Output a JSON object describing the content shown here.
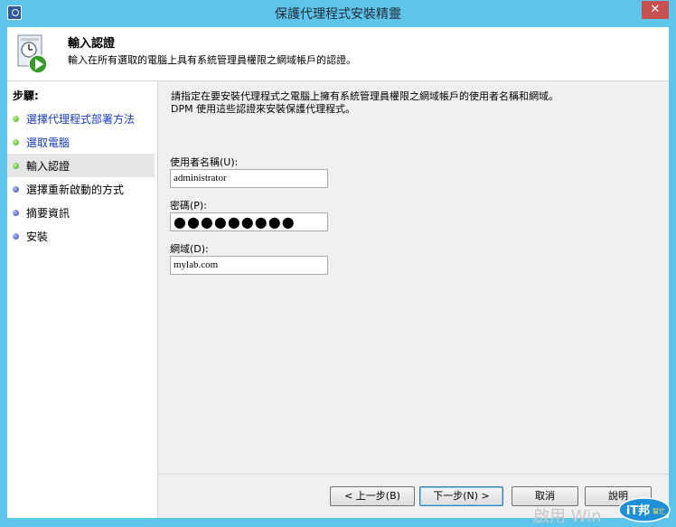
{
  "window": {
    "title": "保護代理程式安裝精靈",
    "close_label": "✕"
  },
  "header": {
    "title": "輸入認證",
    "subtitle": "輸入在所有選取的電腦上具有系統管理員權限之網域帳戶的認證。"
  },
  "steps": {
    "heading": "步驟:",
    "items": [
      {
        "label": "選擇代理程式部署方法",
        "status": "done"
      },
      {
        "label": "選取電腦",
        "status": "done"
      },
      {
        "label": "輸入認證",
        "status": "current"
      },
      {
        "label": "選擇重新啟動的方式",
        "status": "todo"
      },
      {
        "label": "摘要資訊",
        "status": "todo"
      },
      {
        "label": "安裝",
        "status": "todo"
      }
    ]
  },
  "instructions": {
    "line1": "請指定在要安裝代理程式之電腦上擁有系統管理員權限之網域帳戶的使用者名稱和網域。",
    "line2": "DPM 使用這些認證來安裝保護代理程式。"
  },
  "form": {
    "username_label": "使用者名稱(U):",
    "username_value": "administrator",
    "password_label": "密碼(P):",
    "password_value": "●●●●●●●●●",
    "domain_label": "網域(D):",
    "domain_value": "mylab.com"
  },
  "buttons": {
    "back": "< 上一步(B)",
    "next": "下一步(N) >",
    "cancel": "取消",
    "help": "說明"
  },
  "watermark": {
    "text": "啟用 Win",
    "badge_text": "iT邦",
    "badge_sub": "幫忙"
  }
}
